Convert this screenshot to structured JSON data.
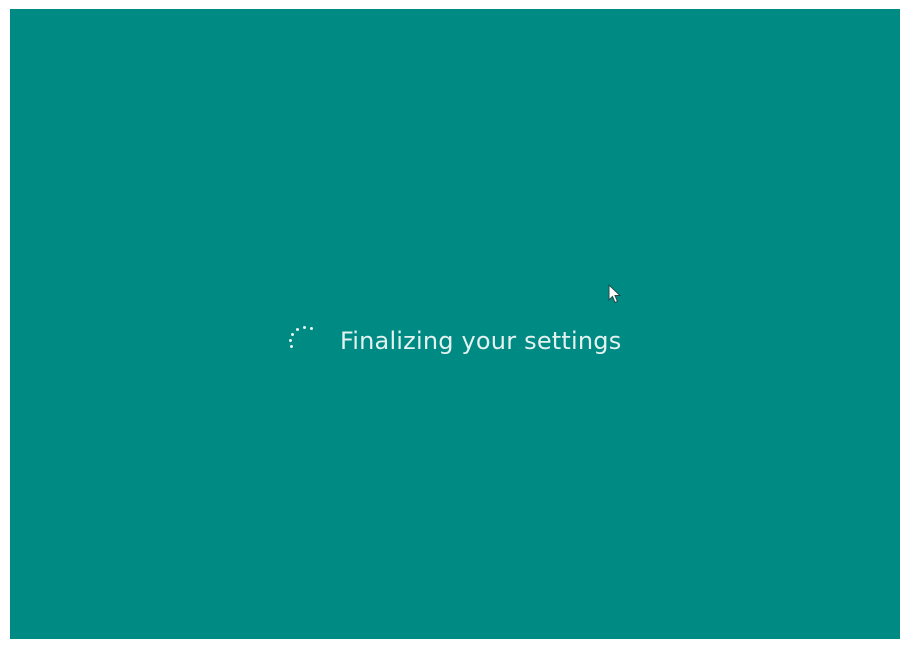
{
  "screen": {
    "background_color": "#008a84",
    "text_color": "#e3f1ef"
  },
  "status": {
    "message": "Finalizing your settings"
  },
  "spinner": {
    "icon": "loading-spinner-icon"
  },
  "cursor": {
    "icon": "mouse-pointer-icon"
  }
}
